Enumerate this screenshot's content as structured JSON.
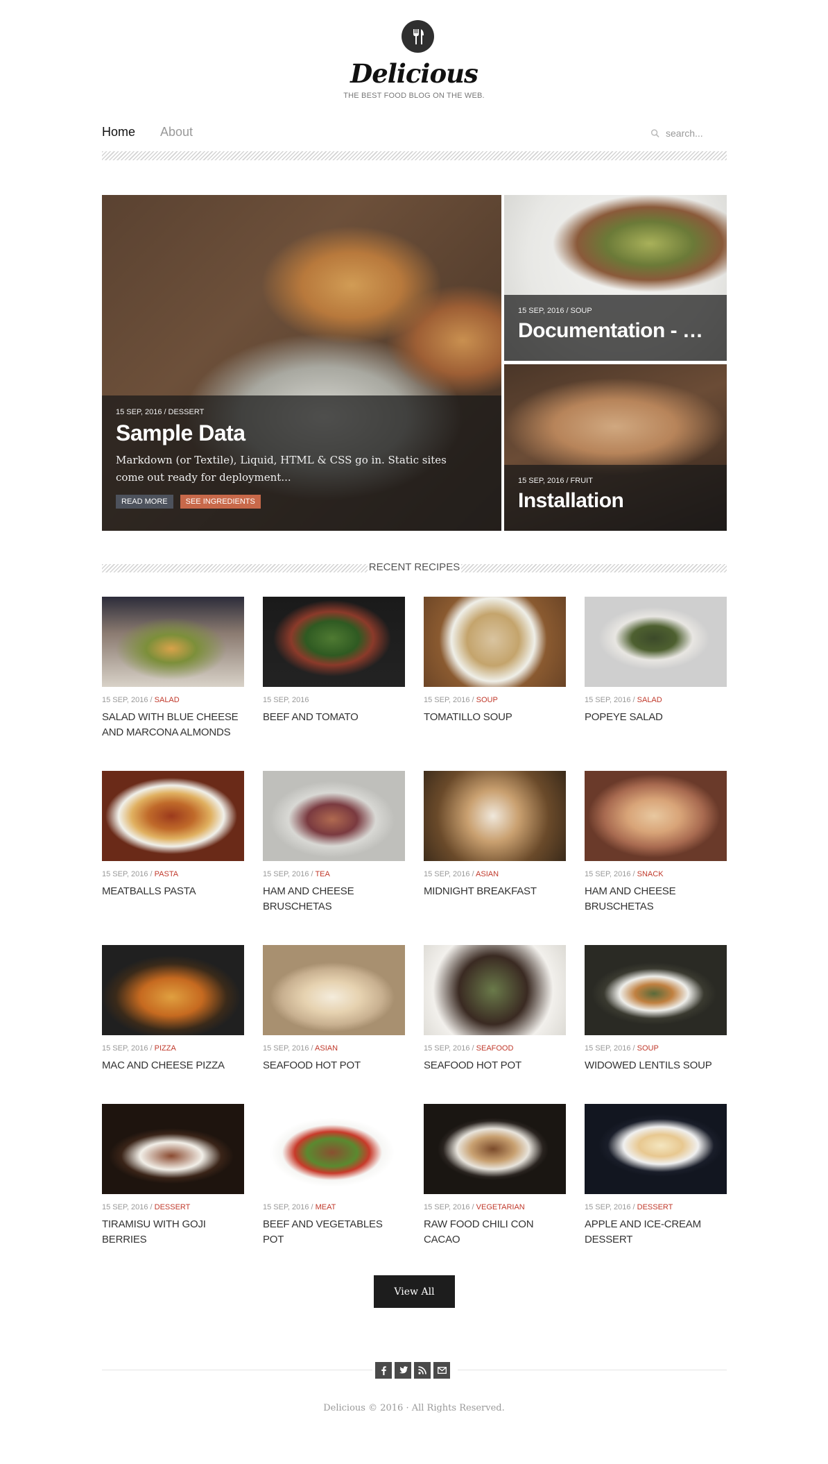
{
  "site": {
    "title": "Delicious",
    "tagline": "THE BEST FOOD BLOG ON THE WEB."
  },
  "nav": {
    "items": [
      {
        "label": "Home",
        "active": true
      },
      {
        "label": "About",
        "active": false
      }
    ],
    "search_placeholder": "search..."
  },
  "featured": [
    {
      "date": "15 SEP, 2016",
      "category": "DESSERT",
      "title": "Sample Data",
      "excerpt": "Markdown (or Textile), Liquid, HTML & CSS go in. Static sites come out ready for deployment...",
      "read_more_label": "READ MORE",
      "ingredients_label": "SEE INGREDIENTS"
    },
    {
      "date": "15 SEP, 2016",
      "category": "SOUP",
      "title": "Documentation - Confi..."
    },
    {
      "date": "15 SEP, 2016",
      "category": "FRUIT",
      "title": "Installation"
    }
  ],
  "recent": {
    "heading": "RECENT RECIPES",
    "items": [
      {
        "date": "15 SEP, 2016",
        "category": "SALAD",
        "title": "SALAD WITH BLUE CHEESE AND MARCONA ALMONDS"
      },
      {
        "date": "15 SEP, 2016",
        "category": "",
        "title": "BEEF AND TOMATO"
      },
      {
        "date": "15 SEP, 2016",
        "category": "SOUP",
        "title": "TOMATILLO SOUP"
      },
      {
        "date": "15 SEP, 2016",
        "category": "SALAD",
        "title": "POPEYE SALAD"
      },
      {
        "date": "15 SEP, 2016",
        "category": "PASTA",
        "title": "MEATBALLS PASTA"
      },
      {
        "date": "15 SEP, 2016",
        "category": "TEA",
        "title": "HAM AND CHEESE BRUSCHETAS"
      },
      {
        "date": "15 SEP, 2016",
        "category": "ASIAN",
        "title": "MIDNIGHT BREAKFAST"
      },
      {
        "date": "15 SEP, 2016",
        "category": "SNACK",
        "title": "HAM AND CHEESE BRUSCHETAS"
      },
      {
        "date": "15 SEP, 2016",
        "category": "PIZZA",
        "title": "MAC AND CHEESE PIZZA"
      },
      {
        "date": "15 SEP, 2016",
        "category": "ASIAN",
        "title": "SEAFOOD HOT POT"
      },
      {
        "date": "15 SEP, 2016",
        "category": "SEAFOOD",
        "title": "SEAFOOD HOT POT"
      },
      {
        "date": "15 SEP, 2016",
        "category": "SOUP",
        "title": "WIDOWED LENTILS SOUP"
      },
      {
        "date": "15 SEP, 2016",
        "category": "DESSERT",
        "title": "TIRAMISU WITH GOJI BERRIES"
      },
      {
        "date": "15 SEP, 2016",
        "category": "MEAT",
        "title": "BEEF AND VEGETABLES POT"
      },
      {
        "date": "15 SEP, 2016",
        "category": "VEGETARIAN",
        "title": "RAW FOOD CHILI CON CACAO"
      },
      {
        "date": "15 SEP, 2016",
        "category": "DESSERT",
        "title": "APPLE AND ICE-CREAM DESSERT"
      }
    ],
    "view_all_label": "View All"
  },
  "footer": {
    "social_icons": [
      "facebook-icon",
      "twitter-icon",
      "rss-icon",
      "email-icon"
    ],
    "copyright": "Delicious © 2016 · All Rights Reserved."
  },
  "colors": {
    "accent": "#c0392b",
    "dark": "#1d1d1d",
    "button_read_more": "#4d525c",
    "button_ingredients": "#c8694a"
  }
}
